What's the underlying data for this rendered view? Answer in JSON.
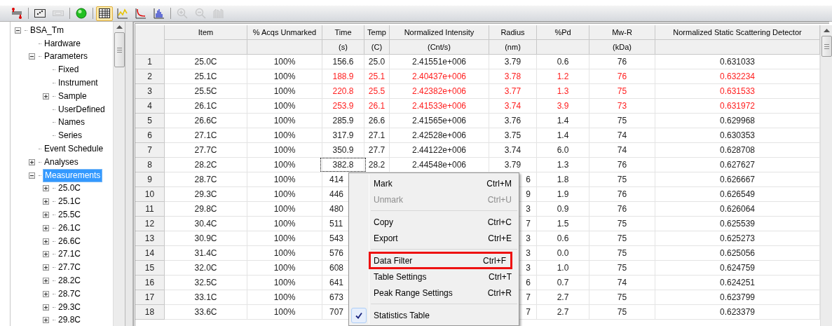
{
  "toolbar": [
    {
      "selected": false,
      "disabled": false
    },
    {
      "selected": false,
      "disabled": false
    },
    {
      "selected": false,
      "disabled": true
    },
    {
      "selected": false,
      "disabled": false
    },
    {
      "selected": true,
      "disabled": false
    },
    {
      "selected": false,
      "disabled": false
    },
    {
      "selected": false,
      "disabled": false
    },
    {
      "selected": false,
      "disabled": false
    },
    {
      "selected": false,
      "disabled": true
    },
    {
      "selected": false,
      "disabled": true
    },
    {
      "selected": false,
      "disabled": true
    }
  ],
  "tree": [
    {
      "label": "BSA_Tm",
      "expanded": true,
      "selected": false,
      "children": [
        {
          "label": "Hardware",
          "selected": false
        },
        {
          "label": "Parameters",
          "expanded": true,
          "selected": false,
          "children": [
            {
              "label": "Fixed",
              "selected": false
            },
            {
              "label": "Instrument",
              "selected": false
            },
            {
              "label": "Sample",
              "expanded": false,
              "selected": false
            },
            {
              "label": "UserDefined",
              "selected": false
            },
            {
              "label": "Names",
              "selected": false
            },
            {
              "label": "Series",
              "selected": false
            }
          ]
        },
        {
          "label": "Event Schedule",
          "selected": false
        },
        {
          "label": "Analyses",
          "expanded": false,
          "selected": false
        },
        {
          "label": "Measurements",
          "expanded": true,
          "selected": true,
          "children": [
            {
              "label": "25.0C",
              "expanded": false,
              "selected": false
            },
            {
              "label": "25.1C",
              "expanded": false,
              "selected": false
            },
            {
              "label": "25.5C",
              "expanded": false,
              "selected": false
            },
            {
              "label": "26.1C",
              "expanded": false,
              "selected": false
            },
            {
              "label": "26.6C",
              "expanded": false,
              "selected": false
            },
            {
              "label": "27.1C",
              "expanded": false,
              "selected": false
            },
            {
              "label": "27.7C",
              "expanded": false,
              "selected": false
            },
            {
              "label": "28.2C",
              "expanded": false,
              "selected": false
            },
            {
              "label": "28.7C",
              "expanded": false,
              "selected": false
            },
            {
              "label": "29.3C",
              "expanded": false,
              "selected": false
            },
            {
              "label": "29.8C",
              "expanded": false,
              "selected": false
            }
          ]
        }
      ]
    }
  ],
  "table": {
    "columns": [
      {
        "name": "Item"
      },
      {
        "name": "% Acqs Unmarked"
      },
      {
        "name": "Time",
        "unit": "(s)"
      },
      {
        "name": "Temp",
        "unit": "(C)"
      },
      {
        "name": "Normalized Intensity",
        "unit": "(Cnt/s)"
      },
      {
        "name": "Radius",
        "unit": "(nm)"
      },
      {
        "name": "%Pd"
      },
      {
        "name": "Mw-R",
        "unit": "(kDa)"
      },
      {
        "name": "Normalized Static Scattering Detector"
      }
    ],
    "rows": [
      {
        "num": "1",
        "flagged": false,
        "covered": false,
        "focused": false,
        "item": "25.0C",
        "acqs": "100%",
        "time": "156.6",
        "temp": "25.0",
        "intensity": "2.41551e+006",
        "radius": "3.79",
        "pd": "0.6",
        "mw": "76",
        "nssd": "0.631033"
      },
      {
        "num": "2",
        "flagged": true,
        "covered": false,
        "focused": false,
        "item": "25.1C",
        "acqs": "100%",
        "time": "188.9",
        "temp": "25.1",
        "intensity": "2.40437e+006",
        "radius": "3.78",
        "pd": "1.2",
        "mw": "76",
        "nssd": "0.632234"
      },
      {
        "num": "3",
        "flagged": true,
        "covered": false,
        "focused": false,
        "item": "25.5C",
        "acqs": "100%",
        "time": "220.8",
        "temp": "25.5",
        "intensity": "2.42382e+006",
        "radius": "3.77",
        "pd": "1.3",
        "mw": "75",
        "nssd": "0.631533"
      },
      {
        "num": "4",
        "flagged": true,
        "covered": false,
        "focused": false,
        "item": "26.1C",
        "acqs": "100%",
        "time": "253.9",
        "temp": "26.1",
        "intensity": "2.41533e+006",
        "radius": "3.74",
        "pd": "3.9",
        "mw": "73",
        "nssd": "0.631972"
      },
      {
        "num": "5",
        "flagged": false,
        "covered": false,
        "focused": false,
        "item": "26.6C",
        "acqs": "100%",
        "time": "285.9",
        "temp": "26.6",
        "intensity": "2.41565e+006",
        "radius": "3.76",
        "pd": "1.4",
        "mw": "75",
        "nssd": "0.629968"
      },
      {
        "num": "6",
        "flagged": false,
        "covered": false,
        "focused": false,
        "item": "27.1C",
        "acqs": "100%",
        "time": "317.9",
        "temp": "27.1",
        "intensity": "2.42528e+006",
        "radius": "3.75",
        "pd": "1.4",
        "mw": "74",
        "nssd": "0.630353"
      },
      {
        "num": "7",
        "flagged": false,
        "covered": false,
        "focused": false,
        "item": "27.7C",
        "acqs": "100%",
        "time": "350.9",
        "temp": "27.7",
        "intensity": "2.44122e+006",
        "radius": "3.74",
        "pd": "6.0",
        "mw": "74",
        "nssd": "0.628708"
      },
      {
        "num": "8",
        "flagged": false,
        "covered": false,
        "focused": true,
        "item": "28.2C",
        "acqs": "100%",
        "time": "382.8",
        "temp": "28.2",
        "intensity": "2.44548e+006",
        "radius": "3.79",
        "pd": "1.3",
        "mw": "76",
        "nssd": "0.627627"
      },
      {
        "num": "9",
        "flagged": false,
        "covered": true,
        "focused": false,
        "item": "28.7C",
        "acqs": "100%",
        "time": "414",
        "radius": "6",
        "pd": "1.8",
        "mw": "75",
        "nssd": "0.626667"
      },
      {
        "num": "10",
        "flagged": false,
        "covered": true,
        "focused": false,
        "item": "29.3C",
        "acqs": "100%",
        "time": "446",
        "radius": "9",
        "pd": "1.9",
        "mw": "76",
        "nssd": "0.626549"
      },
      {
        "num": "11",
        "flagged": false,
        "covered": true,
        "focused": false,
        "item": "29.8C",
        "acqs": "100%",
        "time": "480",
        "radius": "3",
        "pd": "0.9",
        "mw": "76",
        "nssd": "0.626064"
      },
      {
        "num": "12",
        "flagged": false,
        "covered": true,
        "focused": false,
        "item": "30.4C",
        "acqs": "100%",
        "time": "511",
        "radius": "7",
        "pd": "1.5",
        "mw": "75",
        "nssd": "0.625539"
      },
      {
        "num": "13",
        "flagged": false,
        "covered": true,
        "focused": false,
        "item": "30.9C",
        "acqs": "100%",
        "time": "543",
        "radius": "3",
        "pd": "0.6",
        "mw": "75",
        "nssd": "0.625273"
      },
      {
        "num": "14",
        "flagged": false,
        "covered": true,
        "focused": false,
        "item": "31.4C",
        "acqs": "100%",
        "time": "576",
        "radius": "3",
        "pd": "0.0",
        "mw": "75",
        "nssd": "0.625056"
      },
      {
        "num": "15",
        "flagged": false,
        "covered": true,
        "focused": false,
        "item": "32.0C",
        "acqs": "100%",
        "time": "608",
        "radius": "3",
        "pd": "1.0",
        "mw": "75",
        "nssd": "0.624759"
      },
      {
        "num": "16",
        "flagged": false,
        "covered": true,
        "focused": false,
        "item": "32.5C",
        "acqs": "100%",
        "time": "641",
        "radius": "6",
        "pd": "0.7",
        "mw": "74",
        "nssd": "0.624251"
      },
      {
        "num": "17",
        "flagged": false,
        "covered": true,
        "focused": false,
        "item": "33.1C",
        "acqs": "100%",
        "time": "673",
        "radius": "7",
        "pd": "2.7",
        "mw": "75",
        "nssd": "0.623799"
      },
      {
        "num": "18",
        "flagged": false,
        "covered": true,
        "focused": false,
        "item": "33.6C",
        "acqs": "100%",
        "time": "707",
        "radius": "7",
        "pd": "2.7",
        "mw": "75",
        "nssd": "0.623379"
      }
    ]
  },
  "context_menu": [
    {
      "kind": "item",
      "label": "Mark",
      "shortcut": "Ctrl+M",
      "disabled": false,
      "boxed": false,
      "checked": false
    },
    {
      "kind": "item",
      "label": "Unmark",
      "shortcut": "Ctrl+U",
      "disabled": true,
      "boxed": false,
      "checked": false
    },
    {
      "kind": "separator"
    },
    {
      "kind": "item",
      "label": "Copy",
      "shortcut": "Ctrl+C",
      "disabled": false,
      "boxed": false,
      "checked": false
    },
    {
      "kind": "item",
      "label": "Export",
      "shortcut": "Ctrl+E",
      "disabled": false,
      "boxed": false,
      "checked": false
    },
    {
      "kind": "separator"
    },
    {
      "kind": "item",
      "label": "Data Filter",
      "shortcut": "Ctrl+F",
      "disabled": false,
      "boxed": true,
      "checked": false
    },
    {
      "kind": "item",
      "label": "Table Settings",
      "shortcut": "Ctrl+T",
      "disabled": false,
      "boxed": false,
      "checked": false
    },
    {
      "kind": "item",
      "label": "Peak Range Settings",
      "shortcut": "Ctrl+R",
      "disabled": false,
      "boxed": false,
      "checked": false
    },
    {
      "kind": "separator"
    },
    {
      "kind": "item",
      "label": "Statistics Table",
      "disabled": false,
      "boxed": false,
      "checked": true
    }
  ]
}
